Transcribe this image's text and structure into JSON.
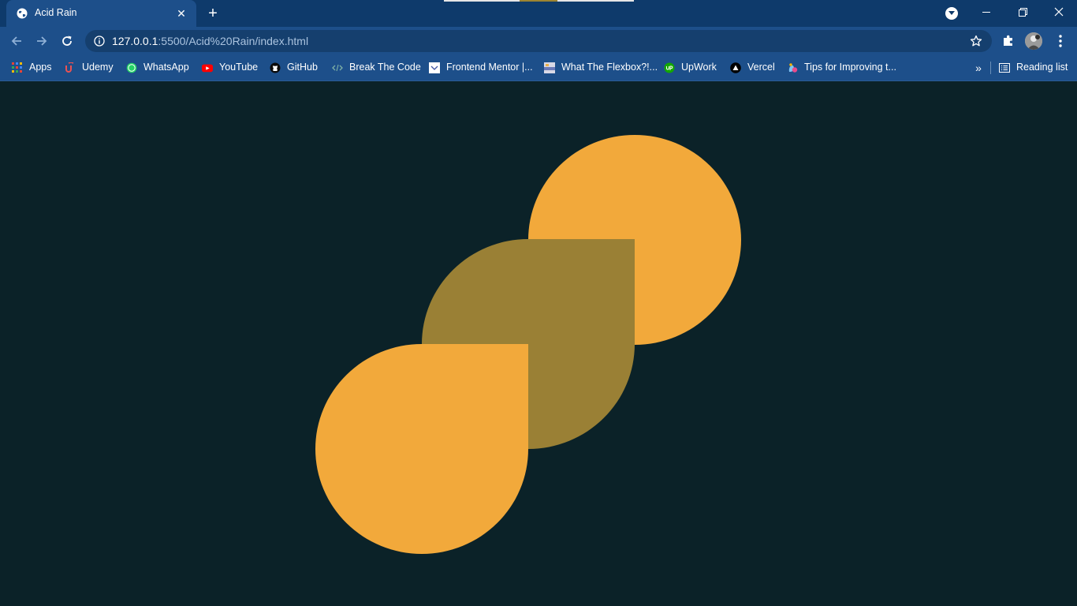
{
  "browser": {
    "tab": {
      "title": "Acid Rain",
      "close_glyph": "✕"
    },
    "new_tab_glyph": "+",
    "window_controls": [
      "minimize-icon",
      "restore-icon",
      "close-icon"
    ],
    "url": {
      "host": "127.0.0.1",
      "path": ":5500/Acid%20Rain/index.html"
    },
    "bookmarks": [
      {
        "label": "Apps",
        "icon": "apps-grid-icon"
      },
      {
        "label": "Udemy",
        "icon": "udemy-icon"
      },
      {
        "label": "WhatsApp",
        "icon": "whatsapp-icon"
      },
      {
        "label": "YouTube",
        "icon": "youtube-icon"
      },
      {
        "label": "GitHub",
        "icon": "github-icon"
      },
      {
        "label": "Break The Code",
        "icon": "code-icon"
      },
      {
        "label": "Frontend Mentor |...",
        "icon": "frontend-mentor-icon"
      },
      {
        "label": "What The Flexbox?!...",
        "icon": "flexbox-icon"
      },
      {
        "label": "UpWork",
        "icon": "upwork-icon"
      },
      {
        "label": "Vercel",
        "icon": "vercel-icon"
      },
      {
        "label": "Tips for Improving t...",
        "icon": "tips-icon"
      }
    ],
    "bookmarks_more_glyph": "»",
    "reading_list_label": "Reading list"
  },
  "colors": {
    "page_background": "#0b2228",
    "drop_primary": "#f2a93b",
    "drop_secondary": "#9a8035",
    "chrome_frame": "#0e3a6b",
    "chrome_toolbar": "#1d4f8a"
  }
}
